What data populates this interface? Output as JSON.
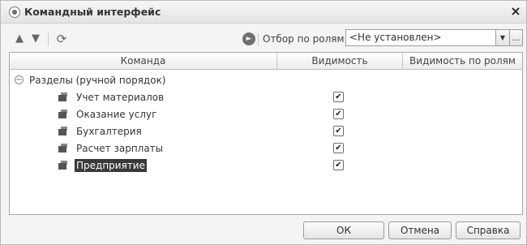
{
  "window": {
    "title": "Командный интерфейс",
    "close_glyph": "×"
  },
  "toolbar": {
    "move_up_glyph": "▲",
    "move_down_glyph": "▼",
    "refresh_glyph": "⟳",
    "filter_label": "Отбор по ролям:",
    "filter_value": "<Не установлен>",
    "dropdown_glyph": "▼",
    "more_glyph": "..."
  },
  "table": {
    "columns": [
      "Команда",
      "Видимость",
      "Видимость по ролям"
    ],
    "group": {
      "label": "Разделы (ручной порядок)",
      "toggle_glyph": "−"
    },
    "rows": [
      {
        "label": "Учет материалов",
        "visible": true
      },
      {
        "label": "Оказание услуг",
        "visible": true
      },
      {
        "label": "Бухгалтерия",
        "visible": true
      },
      {
        "label": "Расчет зарплаты",
        "visible": true
      },
      {
        "label": "Предприятие",
        "visible": true,
        "selected": true
      }
    ],
    "check_glyph": "✔"
  },
  "buttons": {
    "ok": "ОК",
    "cancel": "Отмена",
    "help": "Справка"
  }
}
